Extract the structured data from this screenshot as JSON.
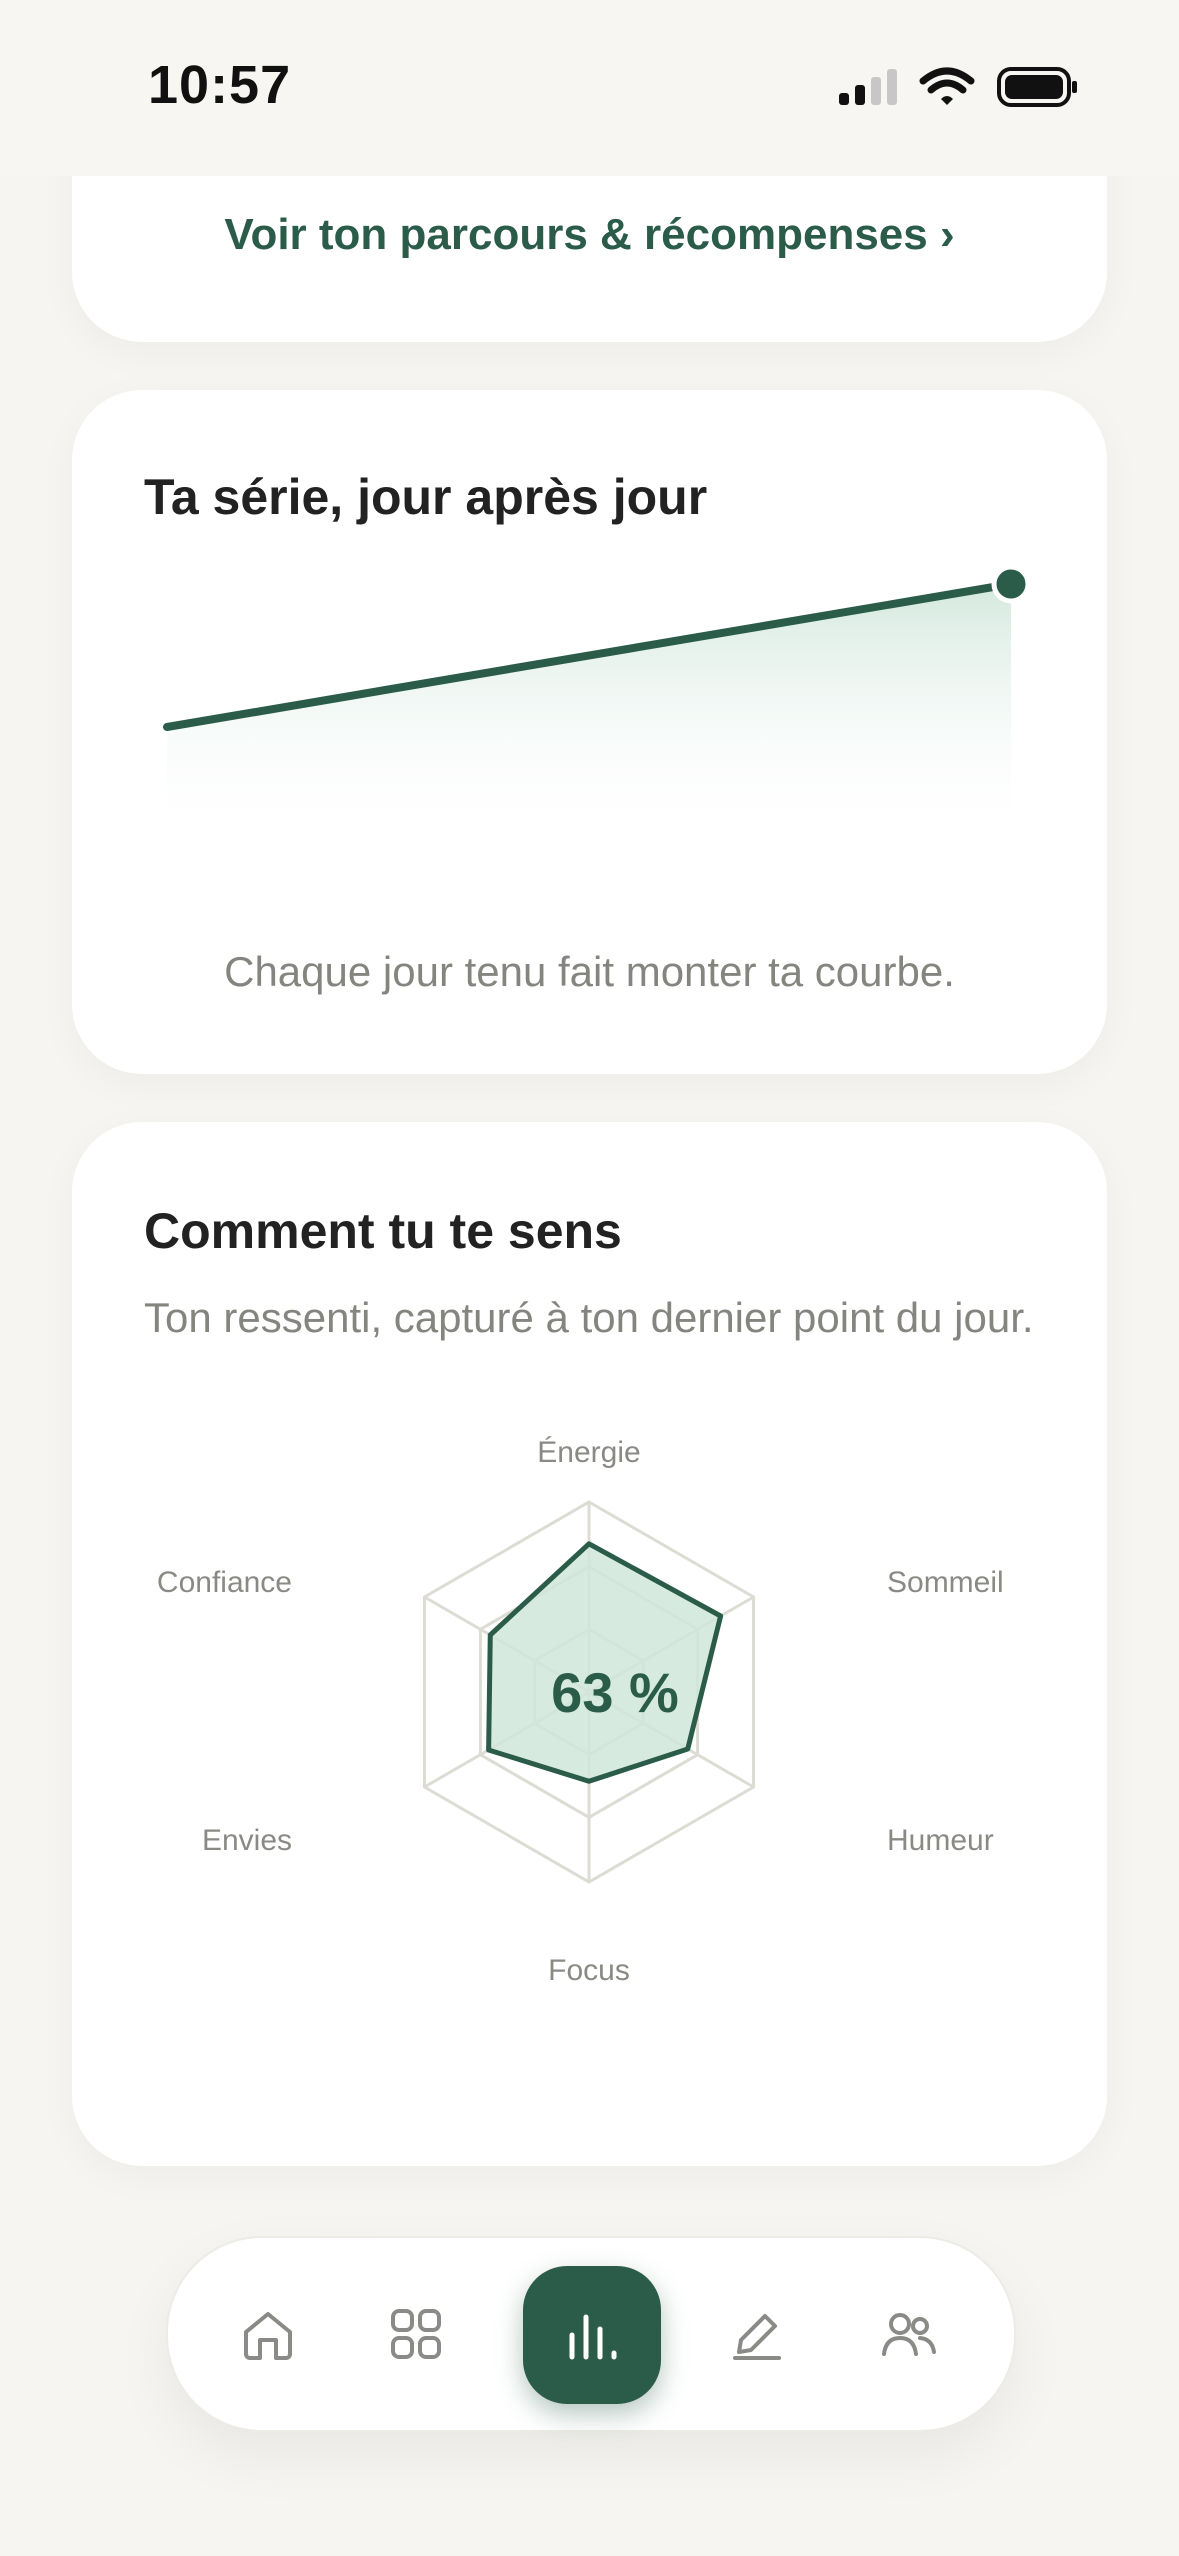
{
  "status_bar": {
    "time": "10:57"
  },
  "journey_card": {
    "link_label": "Voir ton parcours & récompenses ›"
  },
  "streak_card": {
    "title": "Ta série, jour après jour",
    "caption": "Chaque jour tenu fait monter ta courbe."
  },
  "feeling_card": {
    "title": "Comment tu te sens",
    "subtitle": "Ton ressenti, capturé à ton dernier point du jour.",
    "percent_label": "63 %",
    "axes": [
      "Énergie",
      "Sommeil",
      "Humeur",
      "Focus",
      "Envies",
      "Confiance"
    ]
  },
  "chart_data": [
    {
      "type": "area",
      "title": "Ta série, jour après jour",
      "x": [
        0,
        1
      ],
      "series": [
        {
          "values": [
            0.45,
            1.0
          ]
        }
      ]
    },
    {
      "type": "radar",
      "categories": [
        "Énergie",
        "Sommeil",
        "Humeur",
        "Focus",
        "Envies",
        "Confiance"
      ],
      "values": [
        0.78,
        0.8,
        0.6,
        0.47,
        0.61,
        0.6
      ],
      "center_label": "63 %"
    }
  ],
  "nav": {
    "items": [
      {
        "icon": "home-icon"
      },
      {
        "icon": "grid-icon"
      },
      {
        "icon": "stats-icon",
        "active": true
      },
      {
        "icon": "pencil-icon"
      },
      {
        "icon": "community-icon"
      }
    ]
  },
  "colors": {
    "accent": "#2b5c4a",
    "background": "#f6f5f1",
    "muted_text": "#858580"
  }
}
